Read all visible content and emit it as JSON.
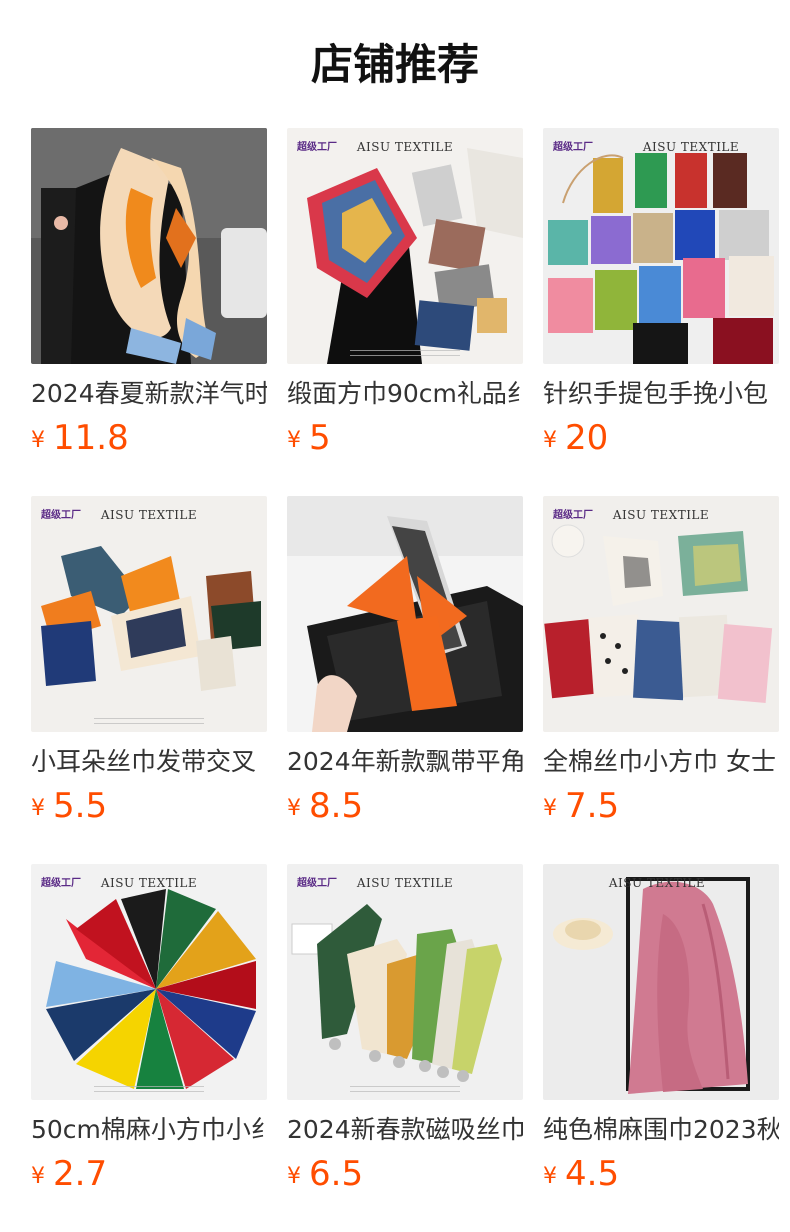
{
  "page": {
    "title": "店铺推荐"
  },
  "products": [
    {
      "name": "2024春夏新款洋气时",
      "currency": "¥",
      "price": "11.8",
      "thumb_icon": "orange-silk-scarf-photo",
      "brand_mark": "",
      "brand_text": ""
    },
    {
      "name": "缎面方巾90cm礼品纟",
      "currency": "¥",
      "price": "5",
      "thumb_icon": "satin-square-scarf-photo",
      "brand_mark": "超级工厂",
      "brand_text": "AISU TEXTILE"
    },
    {
      "name": "针织手提包手挽小包",
      "currency": "¥",
      "price": "20",
      "thumb_icon": "knit-handbags-photo",
      "brand_mark": "超级工厂",
      "brand_text": "AISU TEXTILE"
    },
    {
      "name": "小耳朵丝巾发带交叉",
      "currency": "¥",
      "price": "5.5",
      "thumb_icon": "hair-band-scarves-photo",
      "brand_mark": "超级工厂",
      "brand_text": "AISU TEXTILE"
    },
    {
      "name": "2024年新款飘带平角",
      "currency": "¥",
      "price": "8.5",
      "thumb_icon": "ribbon-scarf-photo",
      "brand_mark": "",
      "brand_text": ""
    },
    {
      "name": "全棉丝巾小方巾 女士",
      "currency": "¥",
      "price": "7.5",
      "thumb_icon": "cotton-small-square-scarves-photo",
      "brand_mark": "超级工厂",
      "brand_text": "AISU TEXTILE"
    },
    {
      "name": "50cm棉麻小方巾小纟",
      "currency": "¥",
      "price": "2.7",
      "thumb_icon": "bandana-fan-photo",
      "brand_mark": "超级工厂",
      "brand_text": "AISU TEXTILE"
    },
    {
      "name": "2024新春款磁吸丝巾",
      "currency": "¥",
      "price": "6.5",
      "thumb_icon": "magnetic-scarves-photo",
      "brand_mark": "超级工厂",
      "brand_text": "AISU TEXTILE"
    },
    {
      "name": "纯色棉麻围巾2023秋",
      "currency": "¥",
      "price": "4.5",
      "thumb_icon": "pink-linen-scarf-photo",
      "brand_mark": "",
      "brand_text": "AISU TEXTILE"
    }
  ],
  "colors": {
    "price": "#ff4d00",
    "title": "#111111",
    "name": "#333333",
    "background": "#ffffff"
  }
}
